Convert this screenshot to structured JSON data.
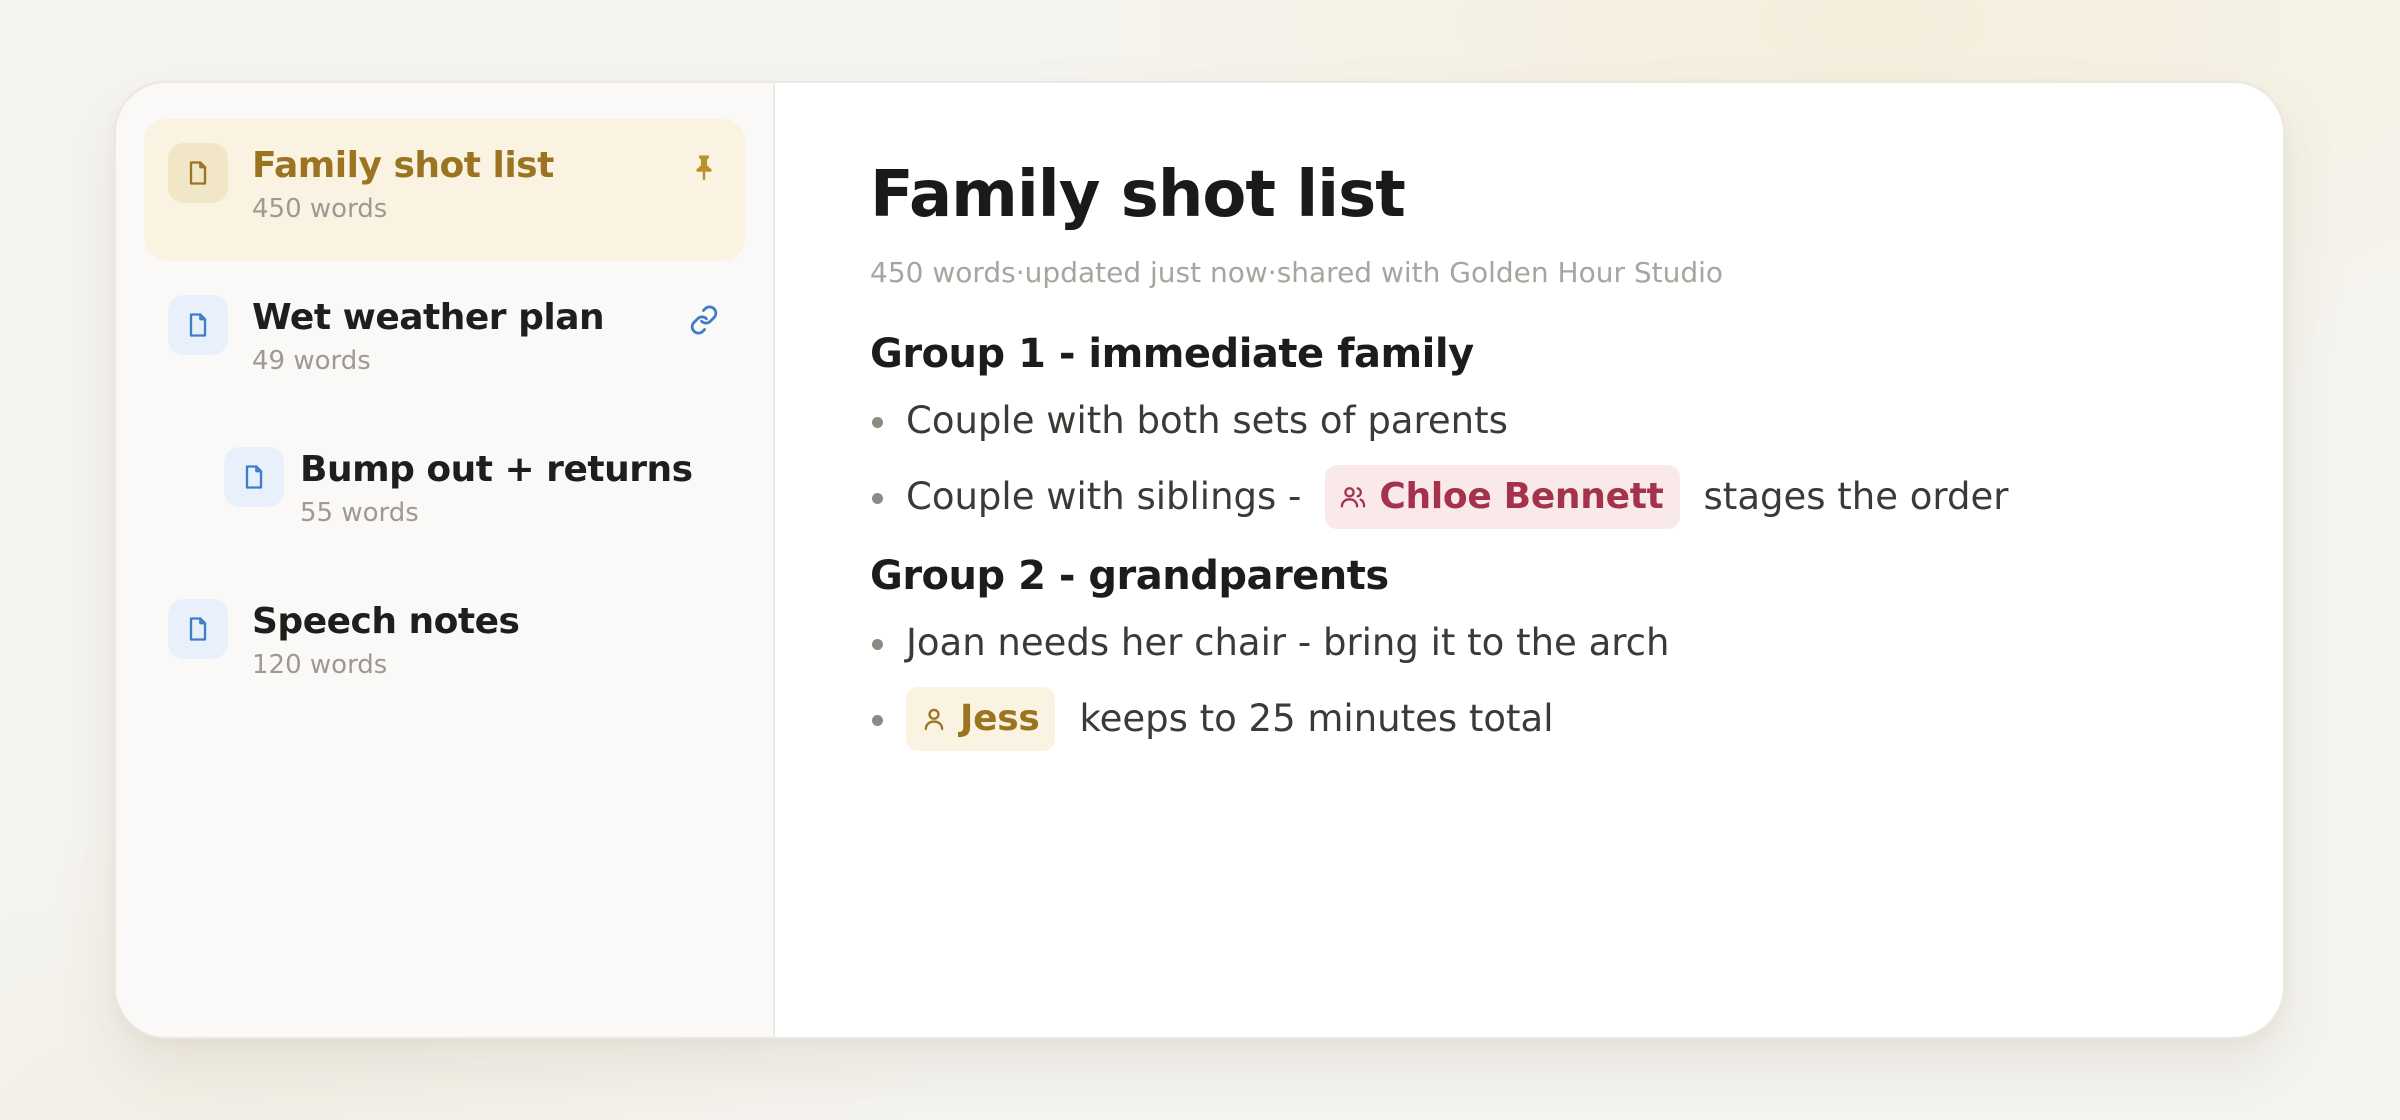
{
  "sidebar": {
    "items": [
      {
        "title": "Family shot list",
        "meta": "450 words",
        "icon": "document-icon",
        "trailing_icon": "pin-icon",
        "active": true
      },
      {
        "title": "Wet weather plan",
        "meta": "49 words",
        "icon": "document-icon",
        "trailing_icon": "link-icon",
        "active": false
      },
      {
        "title": "Bump out + returns",
        "meta": "55 words",
        "icon": "document-icon",
        "nested": true,
        "active": false
      },
      {
        "title": "Speech notes",
        "meta": "120 words",
        "icon": "document-icon",
        "active": false
      }
    ]
  },
  "document": {
    "title": "Family shot list",
    "meta": {
      "words": "450 words",
      "updated": "updated just now",
      "shared": "shared with Golden Hour Studio",
      "separator": "·"
    },
    "sections": [
      {
        "heading": "Group 1 - immediate family",
        "items": [
          {
            "text": "Couple with both sets of parents"
          },
          {
            "before": "Couple with siblings -",
            "mention": "Chloe Bennett",
            "mention_icon": "users-icon",
            "after": "stages the order"
          }
        ]
      },
      {
        "heading": "Group 2 - grandparents",
        "items": [
          {
            "text": "Joan needs her chair - bring it to the arch"
          },
          {
            "mention": "Jess",
            "mention_icon": "user-icon",
            "after": "keeps to 25 minutes total"
          }
        ]
      }
    ]
  },
  "colors": {
    "accent_gold": "#9a7420",
    "active_bg": "#faf3e2",
    "mention_pink_text": "#a3324a",
    "mention_pink_bg": "#f9e9ea",
    "link_blue": "#3f7cc9"
  }
}
